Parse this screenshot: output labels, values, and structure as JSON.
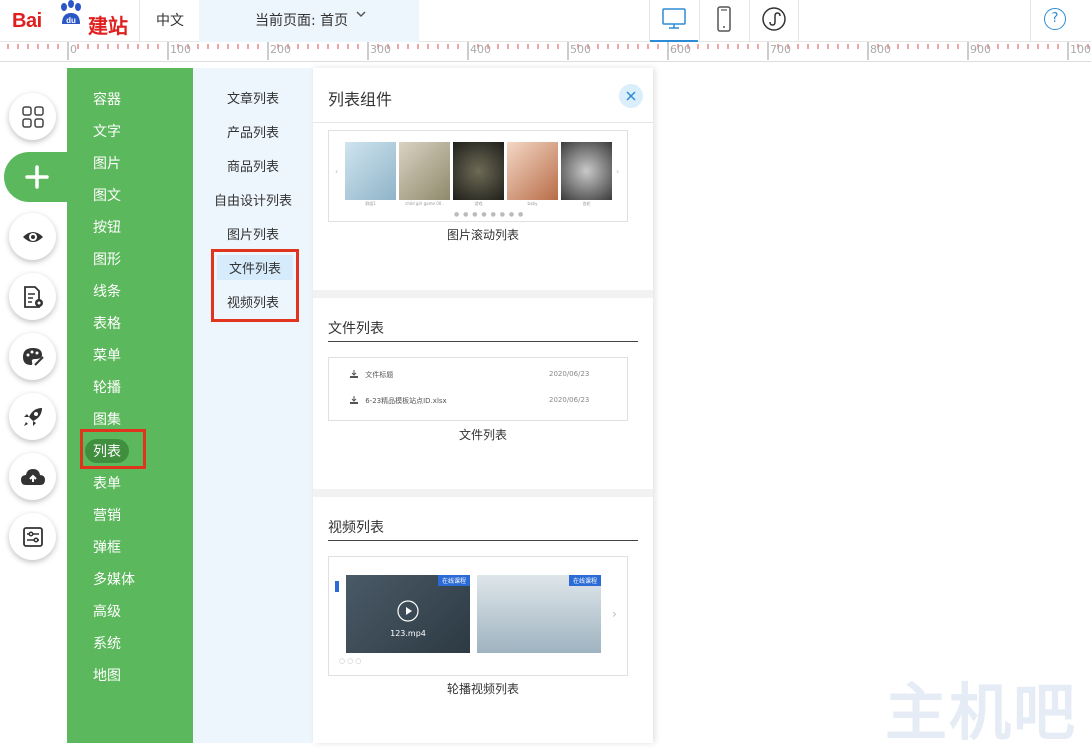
{
  "brand": {
    "logo_latin": "Bai",
    "logo_paw": "du",
    "logo_cn": "建站"
  },
  "header": {
    "language": "中文",
    "current_page": "当前页面: 首页",
    "help": "?"
  },
  "ruler": {
    "labels": [
      "0",
      "100",
      "200",
      "300",
      "400",
      "500",
      "600",
      "700",
      "800",
      "900",
      "100"
    ]
  },
  "category_menu": {
    "items": [
      "容器",
      "文字",
      "图片",
      "图文",
      "按钮",
      "图形",
      "线条",
      "表格",
      "菜单",
      "轮播",
      "图集",
      "列表",
      "表单",
      "营销",
      "弹框",
      "多媒体",
      "高级",
      "系统",
      "地图"
    ],
    "selected": "列表"
  },
  "sub_menu": {
    "items": [
      "文章列表",
      "产品列表",
      "商品列表",
      "自由设计列表",
      "图片列表",
      "文件列表",
      "视频列表"
    ],
    "selected": "文件列表"
  },
  "panel": {
    "title": "列表组件",
    "close_icon": "close-icon",
    "image_scroll": {
      "caption": "图片滚动列表",
      "thumb_captions": [
        "群组1",
        "child girl game 00..",
        "游戏",
        "baby",
        "齿轮"
      ]
    },
    "file_list": {
      "title": "文件列表",
      "rows": [
        {
          "name": "文件标题",
          "date": "2020/06/23"
        },
        {
          "name": "6-23精品模板站点ID.xlsx",
          "date": "2020/06/23"
        }
      ],
      "caption": "文件列表"
    },
    "video_list": {
      "title": "视频列表",
      "videos": [
        {
          "tag": "在线课程",
          "name": "123.mp4"
        },
        {
          "tag": "在线课程",
          "name": ""
        }
      ],
      "caption": "轮播视频列表"
    }
  },
  "watermark": "主机吧",
  "colors": {
    "green": "#5cb85c",
    "accent": "#2b8bd6",
    "highlight": "#e0341f"
  }
}
